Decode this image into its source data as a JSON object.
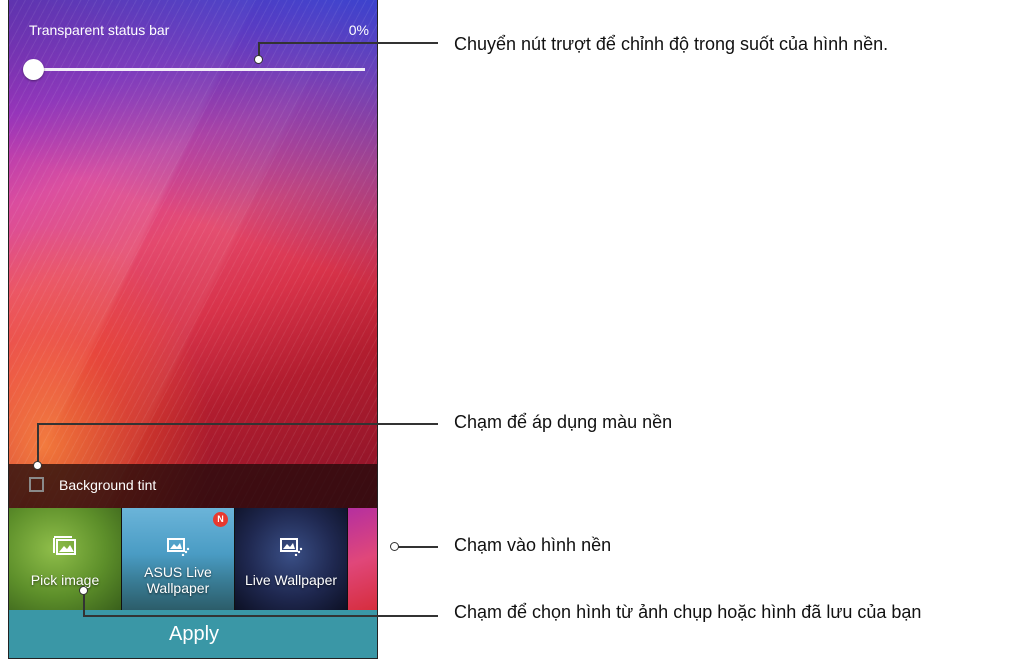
{
  "status_bar_setting": {
    "label": "Transparent status bar",
    "value": "0%",
    "slider_fraction": 0.0
  },
  "background_tint": {
    "label": "Background tint",
    "checked": false
  },
  "wallpapers": [
    {
      "label": "Pick image",
      "icon": "image-gallery-icon"
    },
    {
      "label": "ASUS Live Wallpaper",
      "icon": "live-wallpaper-icon",
      "badge": "N"
    },
    {
      "label": "Live Wallpaper",
      "icon": "live-wallpaper-icon"
    }
  ],
  "apply_label": "Apply",
  "callouts": [
    "Chuyển nút trượt để chỉnh độ trong suốt của hình nền.",
    "Chạm để áp dụng màu nền",
    "Chạm vào hình nền",
    "Chạm để chọn hình từ ảnh chụp hoặc hình đã lưu của bạn"
  ],
  "colors": {
    "apply_button": "#3a97a6",
    "badge": "#e8392f"
  }
}
